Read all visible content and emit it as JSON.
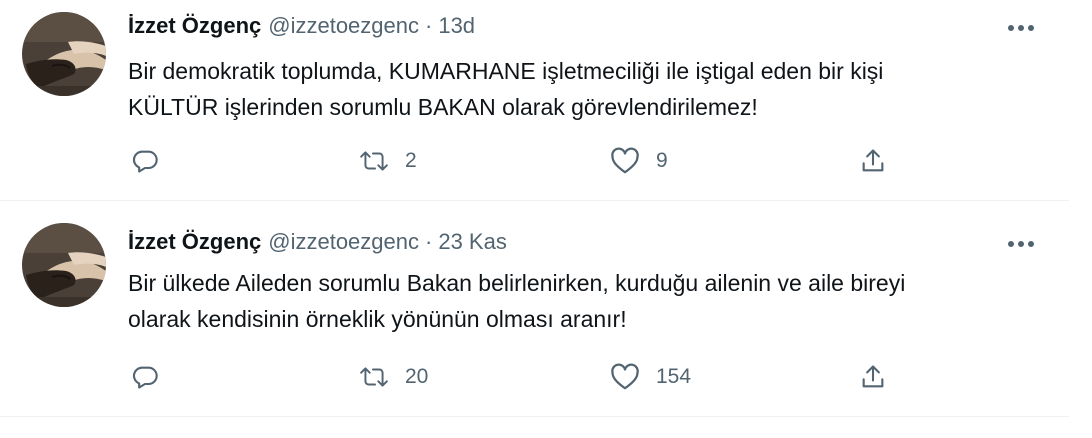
{
  "tweets": [
    {
      "author": {
        "name": "İzzet Özgenç",
        "handle": "@izzetoezgenc"
      },
      "separator": "·",
      "time": "13d",
      "lines": [
        "Bir demokratik toplumda, KUMARHANE işletmeciliği ile iştigal eden bir kişi",
        "KÜLTÜR işlerinden sorumlu BAKAN olarak görevlendirilemez!"
      ],
      "stats": {
        "replies": "",
        "retweets": "2",
        "likes": "9"
      }
    },
    {
      "author": {
        "name": "İzzet Özgenç",
        "handle": "@izzetoezgenc"
      },
      "separator": "·",
      "time": "23 Kas",
      "lines": [
        "Bir ülkede Aileden sorumlu Bakan belirlenirken, kurduğu ailenin ve aile bireyi",
        "olarak kendisinin örneklik yönünün olması aranır!"
      ],
      "stats": {
        "replies": "",
        "retweets": "20",
        "likes": "154"
      }
    }
  ],
  "icons": {
    "more": "more-horizontal-icon",
    "reply": "reply-icon",
    "retweet": "retweet-icon",
    "like": "heart-icon",
    "share": "share-icon"
  },
  "colors": {
    "secondary_text": "#536471",
    "primary_text": "#0f1419",
    "divider": "#eff3f4"
  }
}
